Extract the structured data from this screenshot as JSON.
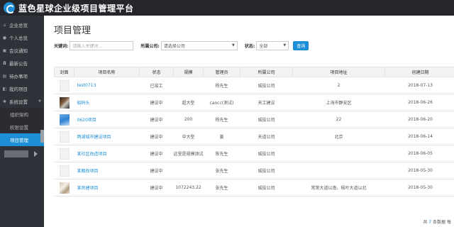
{
  "app": {
    "title": "蓝色星球企业级项目管理平台"
  },
  "sidebar": {
    "items": [
      {
        "label": "企业总览",
        "icon": "home-icon"
      },
      {
        "label": "个人总览",
        "icon": "user-icon"
      },
      {
        "label": "会议通知",
        "icon": "meeting-icon"
      },
      {
        "label": "最新公告",
        "icon": "announcement-icon"
      },
      {
        "label": "待办事项",
        "icon": "todo-icon"
      },
      {
        "label": "我的项目",
        "icon": "project-icon"
      },
      {
        "label": "系统设置",
        "icon": "settings-icon"
      }
    ],
    "subitems": [
      {
        "label": "组织架构"
      },
      {
        "label": "权限设置"
      },
      {
        "label": "项目管理"
      }
    ]
  },
  "main": {
    "title": "项目管理",
    "filters": {
      "keyword_label": "关键词:",
      "keyword_placeholder": "请输入关键词...",
      "company_label": "所属公司:",
      "company_value": "请选择公司",
      "status_label": "状态:",
      "status_value": "全部",
      "search_label": "查询"
    },
    "table": {
      "headers": [
        "封面",
        "项目名称",
        "状态",
        "规模",
        "管理员",
        "所属公司",
        "项目地址",
        "创建日期"
      ],
      "rows": [
        {
          "cover": "blank",
          "name": "test0713",
          "status": "已竣工",
          "scale": "",
          "admin": "杨先生",
          "company": "城投公司",
          "address": "2",
          "date": "2018-07-13"
        },
        {
          "cover": "photo",
          "name": "船码头",
          "status": "建设中",
          "scale": "超大型",
          "admin": "caocc(测试)",
          "company": "天工建设",
          "address": "上海市静安区",
          "date": "2018-06-26"
        },
        {
          "cover": "photo",
          "name": "0620项目",
          "status": "建设中",
          "scale": "200",
          "admin": "杨先生",
          "company": "城投公司",
          "address": "22",
          "date": "2018-06-20"
        },
        {
          "cover": "blank",
          "name": "两湖城市建设项目",
          "status": "建设中",
          "scale": "中大型",
          "admin": "姜",
          "company": "天道公司",
          "address": "北京",
          "date": "2018-06-14"
        },
        {
          "cover": "blank",
          "name": "某社区改造项目",
          "status": "建设中",
          "scale": "这里是规模测试",
          "admin": "陈先生",
          "company": "城投公司",
          "address": "",
          "date": "2018-06-05"
        },
        {
          "cover": "blank",
          "name": "某棚改项目",
          "status": "建设中",
          "scale": "",
          "admin": "张先生",
          "company": "城投公司",
          "address": "",
          "date": "2018-05-30"
        },
        {
          "cover": "photo",
          "name": "某房建项目",
          "status": "建设中",
          "scale": "1072243.22",
          "admin": "张先生",
          "company": "城投公司",
          "address": "常常大道以南、梧叶大道以北",
          "date": "2018-05-30"
        }
      ]
    },
    "footer": {
      "prefix": "共",
      "count": "7",
      "suffix": "条数据",
      "extra": "每"
    }
  },
  "colors": {
    "accent": "#1e8fd6",
    "header_bg": "#24262b",
    "sidebar_bg": "#2f3238"
  }
}
